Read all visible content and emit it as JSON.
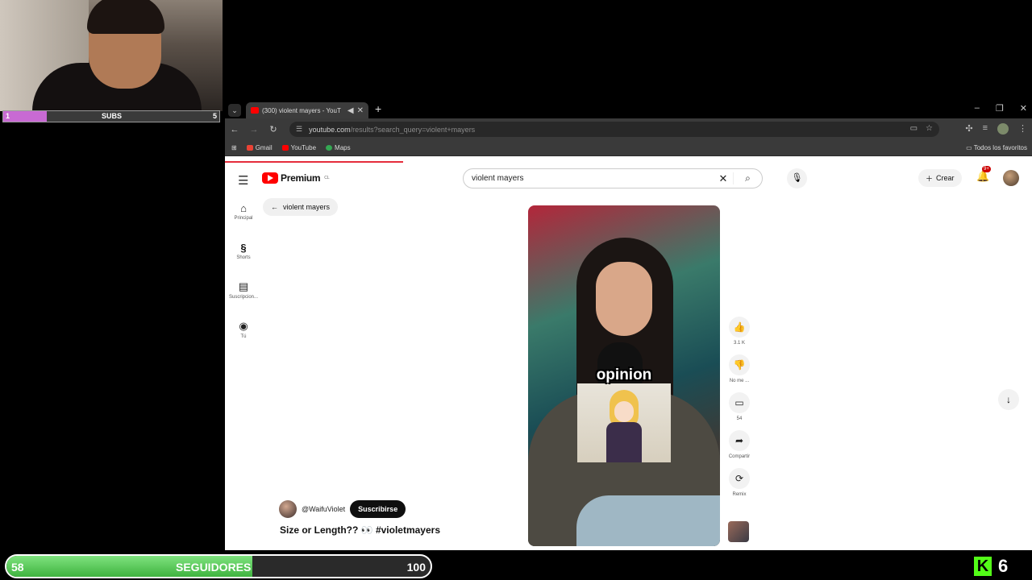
{
  "overlay": {
    "subs_label": "SUBS",
    "subs_current": "1",
    "subs_goal": "5",
    "subs_progress": 0.2,
    "followers_current": "58",
    "followers_label": "SEGUIDORES",
    "followers_goal": "100",
    "followers_progress": 0.58,
    "kick_viewers": "6",
    "kick_logo": "K"
  },
  "browser": {
    "tab_title": "(300) violent mayers - YouT",
    "tab_close": "✕",
    "tab_dropdown": "⌄",
    "new_tab": "+",
    "window_controls": [
      "–",
      "❐",
      "✕"
    ],
    "url_host": "youtube.com",
    "url_path": "/results?search_query=violent+mayers",
    "bookmarks": [
      {
        "label": "Gmail",
        "color": "#ea4335"
      },
      {
        "label": "YouTube",
        "color": "#ff0000"
      },
      {
        "label": "Maps",
        "color": "#34a853"
      }
    ],
    "all_bookmarks": "Todos los favoritos"
  },
  "youtube": {
    "logo_text": "Premium",
    "logo_region": "CL",
    "search_query": "violent mayers",
    "create_label": "Crear",
    "notif_badge": "9+",
    "sidebar": [
      {
        "label": "Principal",
        "icon": "home-icon",
        "glyph": "⌂"
      },
      {
        "label": "Shorts",
        "icon": "shorts-icon",
        "glyph": "§"
      },
      {
        "label": "Suscripcion...",
        "icon": "subscriptions-icon",
        "glyph": "▤"
      },
      {
        "label": "Tú",
        "icon": "you-icon",
        "glyph": "◉"
      }
    ],
    "back_chip": "violent mayers",
    "caption": "opinion",
    "actions": [
      {
        "label": "3.1 K",
        "icon": "like-icon",
        "glyph": "👍"
      },
      {
        "label": "No me ...",
        "icon": "dislike-icon",
        "glyph": "👎"
      },
      {
        "label": "54",
        "icon": "comment-icon",
        "glyph": "▭"
      },
      {
        "label": "Compartir",
        "icon": "share-icon",
        "glyph": "➦"
      },
      {
        "label": "Remix",
        "icon": "remix-icon",
        "glyph": "⟳"
      }
    ],
    "channel": "@WaifuViolet",
    "subscribe": "Suscribirse",
    "video_title": "Size or Length?? 👀 #violetmayers"
  }
}
